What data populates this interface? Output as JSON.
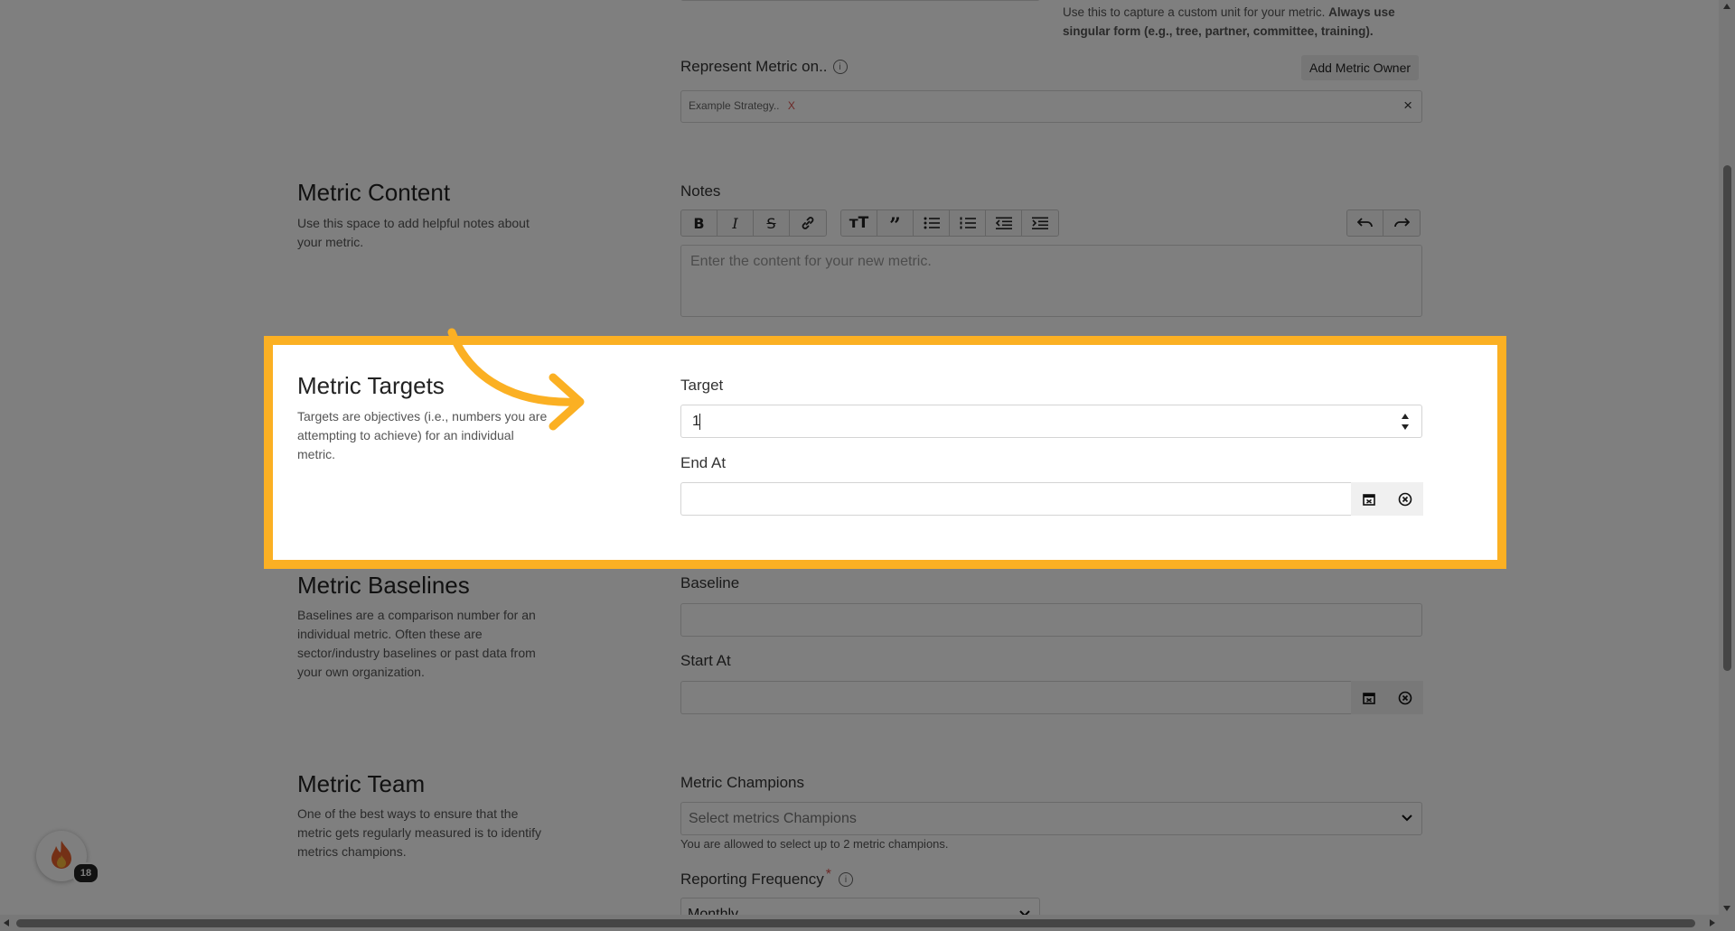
{
  "unit_help": {
    "text_plain": "Use this to capture a custom unit for your metric.",
    "text_bold_1": "Always use",
    "text_bold_2": "singular form (e.g., tree, partner, committee, training)."
  },
  "represent": {
    "label": "Represent Metric on..",
    "add_owner_label": "Add Metric Owner",
    "tag_label": "Example Strategy..",
    "tag_remove": "X",
    "clear": "×"
  },
  "metric_content": {
    "title": "Metric Content",
    "desc_1": "Use this space to add helpful notes about",
    "desc_2": "your metric.",
    "notes_label": "Notes",
    "notes_placeholder": "Enter the content for your new metric.",
    "toolbar": [
      "bold",
      "italic",
      "strikethrough",
      "link",
      "heading",
      "quote",
      "bulleted-list",
      "numbered-list",
      "outdent",
      "indent",
      "undo",
      "redo"
    ]
  },
  "metric_targets": {
    "title": "Metric Targets",
    "desc_1": "Targets are objectives (i.e., numbers you are",
    "desc_2": "attempting to achieve) for an individual",
    "desc_3": "metric.",
    "target_label": "Target",
    "target_value": "1",
    "end_at_label": "End At"
  },
  "metric_baselines": {
    "title": "Metric Baselines",
    "desc_1": "Baselines are a comparison number for an",
    "desc_2": "individual metric. Often these are",
    "desc_3": "sector/industry baselines or past data from",
    "desc_4": "your own organization.",
    "baseline_label": "Baseline",
    "start_at_label": "Start At"
  },
  "metric_team": {
    "title": "Metric Team",
    "desc_1": "One of the best ways to ensure that the",
    "desc_2": "metric gets regularly measured is to identify",
    "desc_3": "metrics champions.",
    "champions_label": "Metric Champions",
    "champions_placeholder": "Select metrics Champions",
    "champions_help": "You are allowed to select up to 2 metric champions.",
    "frequency_label": "Reporting Frequency",
    "frequency_required": "*",
    "frequency_value": "Monthly"
  },
  "badge": {
    "count": "18"
  },
  "colors": {
    "highlight": "#fbb023",
    "remove_x": "#d9534f",
    "required": "#d9534f"
  }
}
